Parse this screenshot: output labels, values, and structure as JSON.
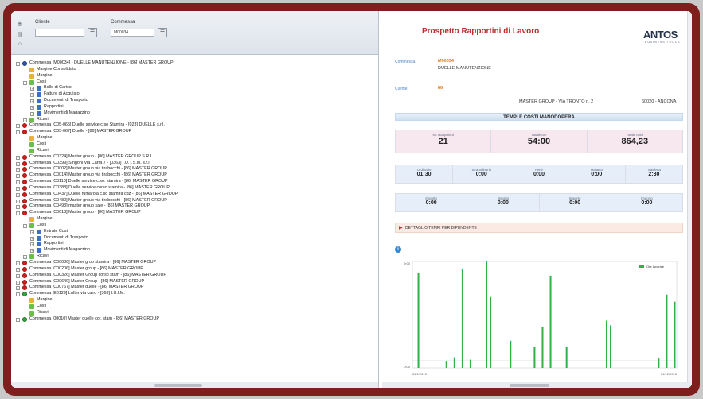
{
  "filters": {
    "cliente_label": "Cliente",
    "cliente_value": "",
    "commessa_label": "Commessa",
    "commessa_value": "M00034"
  },
  "tree": [
    {
      "level": 0,
      "icon": "blue",
      "toggle": "-",
      "text": "Commessa [M00034] - DUELLE MANUTENZIONE - [86] MASTER GROUP"
    },
    {
      "level": 1,
      "icon": "bar",
      "toggle": "",
      "text": "Margine Consolidato"
    },
    {
      "level": 1,
      "icon": "bar",
      "toggle": "",
      "text": "Margine"
    },
    {
      "level": 1,
      "icon": "folder",
      "toggle": "-",
      "text": "Costi"
    },
    {
      "level": 2,
      "icon": "cost",
      "toggle": "+",
      "text": "Bolle di Carico"
    },
    {
      "level": 2,
      "icon": "cost",
      "toggle": "+",
      "text": "Fatture di Acquisto"
    },
    {
      "level": 2,
      "icon": "cost",
      "toggle": "+",
      "text": "Documenti di Trasporto"
    },
    {
      "level": 2,
      "icon": "cost",
      "toggle": "+",
      "text": "Rapportini"
    },
    {
      "level": 2,
      "icon": "cost",
      "toggle": "+",
      "text": "Movimenti di Magazzino"
    },
    {
      "level": 1,
      "icon": "folder",
      "toggle": "+",
      "text": "Ricavi"
    },
    {
      "level": 0,
      "icon": "red",
      "toggle": "+",
      "text": "Commessa [C05-065] Duelle service c.so Stamira - [023] DUELLE s.r.l."
    },
    {
      "level": 0,
      "icon": "red",
      "toggle": "-",
      "text": "Commessa [C05-067] Duelle - [86] MASTER GROUP"
    },
    {
      "level": 1,
      "icon": "bar",
      "toggle": "",
      "text": "Margine"
    },
    {
      "level": 1,
      "icon": "folder",
      "toggle": "",
      "text": "Costi"
    },
    {
      "level": 1,
      "icon": "folder",
      "toggle": "",
      "text": "Ricavi"
    },
    {
      "level": 0,
      "icon": "red",
      "toggle": "+",
      "text": "Commessa [C0324] Master group - [86] MASTER GROUP S.R.L."
    },
    {
      "level": 0,
      "icon": "red",
      "toggle": "+",
      "text": "Commessa [C0399] Singoni Via Carrà 7 - [0363] I.U.T.S.M. s.r.l."
    },
    {
      "level": 0,
      "icon": "red",
      "toggle": "+",
      "text": "Commessa [C0002] Master group via tirabocchi - [86] MASTER GROUP"
    },
    {
      "level": 0,
      "icon": "red",
      "toggle": "+",
      "text": "Commessa [C0014] Master group via tirabocchi - [86] MASTER GROUP"
    },
    {
      "level": 0,
      "icon": "red",
      "toggle": "+",
      "text": "Commessa [C0116] Duelle service c.so. stamira - [86] MASTER GROUP"
    },
    {
      "level": 0,
      "icon": "red",
      "toggle": "+",
      "text": "Commessa [C0388] Duelle service corso stamira - [86] MASTER GROUP"
    },
    {
      "level": 0,
      "icon": "red",
      "toggle": "+",
      "text": "Commessa [C0437] Duelle fumarola c.so stamira cdz - [86] MASTER GROUP"
    },
    {
      "level": 0,
      "icon": "red",
      "toggle": "+",
      "text": "Commessa [C0480] Master group via tirabocchi - [86] MASTER GROUP"
    },
    {
      "level": 0,
      "icon": "red",
      "toggle": "+",
      "text": "Commessa [C0493] master group sale - [86] MASTER GROUP"
    },
    {
      "level": 0,
      "icon": "red",
      "toggle": "-",
      "text": "Commessa [C0618] Master group - [86] MASTER GROUP"
    },
    {
      "level": 1,
      "icon": "bar",
      "toggle": "",
      "text": "Margine"
    },
    {
      "level": 1,
      "icon": "folder",
      "toggle": "-",
      "text": "Costi"
    },
    {
      "level": 2,
      "icon": "cost",
      "toggle": "+",
      "text": "Entrate Costi"
    },
    {
      "level": 2,
      "icon": "cost",
      "toggle": "+",
      "text": "Documenti di Trasporto"
    },
    {
      "level": 2,
      "icon": "cost",
      "toggle": "+",
      "text": "Rapportini"
    },
    {
      "level": 2,
      "icon": "cost",
      "toggle": "+",
      "text": "Movimenti di Magazzino"
    },
    {
      "level": 1,
      "icon": "folder",
      "toggle": "+",
      "text": "Ricavi"
    },
    {
      "level": 0,
      "icon": "red",
      "toggle": "+",
      "text": "Commessa [C00086] Master grup stamira - [86] MASTER GROUP"
    },
    {
      "level": 0,
      "icon": "red",
      "toggle": "+",
      "text": "Commessa [C00206] Master group - [86] MASTER GROUP"
    },
    {
      "level": 0,
      "icon": "red",
      "toggle": "+",
      "text": "Commessa [C00326] Master Group corso stam - [86] MASTER GROUP"
    },
    {
      "level": 0,
      "icon": "red",
      "toggle": "+",
      "text": "Commessa [C00640] Master Group - [86] MASTER GROUP"
    },
    {
      "level": 0,
      "icon": "red",
      "toggle": "+",
      "text": "Commessa [C00767] Master duelle - [86] MASTER GROUP"
    },
    {
      "level": 0,
      "icon": "green",
      "toggle": "-",
      "text": "Commessa [E0129] Lufter via cairo - [363] I.U.I.M."
    },
    {
      "level": 1,
      "icon": "bar",
      "toggle": "",
      "text": "Margine"
    },
    {
      "level": 1,
      "icon": "folder",
      "toggle": "",
      "text": "Costi"
    },
    {
      "level": 1,
      "icon": "folder",
      "toggle": "",
      "text": "Ricavi"
    },
    {
      "level": 0,
      "icon": "green",
      "toggle": "+",
      "text": "Commessa [00010] Master duelle cor. stam - [86] MASTER GROUP"
    }
  ],
  "report": {
    "title": "Prospetto Rapportini di Lavoro",
    "logo": "ANTOS",
    "logo_sub": "BUSINESS TOOLS",
    "commessa_label": "Commessa",
    "commessa_code": "M00034",
    "commessa_desc": "DUELLE MANUTENZIONE",
    "cliente_label": "Cliente",
    "cliente_code": "86",
    "address": "MASTER GROUP - VIA TRONTO n. 2",
    "city": "60020 - ANCONA",
    "section_title": "TEMPI E COSTI MANODOPERA",
    "kpi_main": [
      {
        "label": "Nr. Rapportini",
        "value": "21"
      },
      {
        "label": "Totale ore",
        "value": "54:00"
      },
      {
        "label": "Totale costi",
        "value": "864,23"
      }
    ],
    "kpi_row2": [
      {
        "label": "Ordinario",
        "value": "01:30"
      },
      {
        "label": "Straordinario",
        "value": "0:00"
      },
      {
        "label": "Ferie",
        "value": "0:00"
      },
      {
        "label": "Malattia",
        "value": "0:00"
      },
      {
        "label": "Trasferta",
        "value": "2:30"
      }
    ],
    "kpi_row3": [
      {
        "label": "Importo",
        "value": "0:00"
      },
      {
        "label": "Importo",
        "value": "0:00"
      },
      {
        "label": "Importo",
        "value": "0:00"
      },
      {
        "label": "Importo",
        "value": "0:00"
      }
    ],
    "detail_label": "DETTAGLIO TEMPI PER DIPENDENTE"
  },
  "chart_data": {
    "type": "bar",
    "legend": [
      "Ore lavorate"
    ],
    "legend_position": "top-right",
    "ylim": [
      0,
      9
    ],
    "y_ticks": [
      "9:00",
      "0:00"
    ],
    "x_ticks": [
      "01/1/2013",
      "31/12/2013"
    ],
    "series": [
      {
        "name": "Ore lavorate",
        "color": "#33b04a",
        "values": [
          0,
          8,
          0,
          0,
          0,
          0,
          0,
          0,
          0.6,
          0,
          0.9,
          0,
          8.4,
          0,
          0.7,
          0,
          0,
          0,
          9,
          6,
          0,
          0,
          0,
          0,
          2.3,
          0,
          0,
          0,
          0,
          0,
          1.8,
          0,
          3.5,
          0,
          7.8,
          0,
          0,
          0,
          1.8,
          0,
          0,
          0,
          0,
          0,
          0,
          0,
          0,
          0,
          4,
          3.6,
          0,
          0,
          0,
          0,
          0,
          0,
          0,
          0,
          0,
          0,
          0,
          0.8,
          0,
          6.2,
          0,
          5.6
        ]
      }
    ]
  }
}
